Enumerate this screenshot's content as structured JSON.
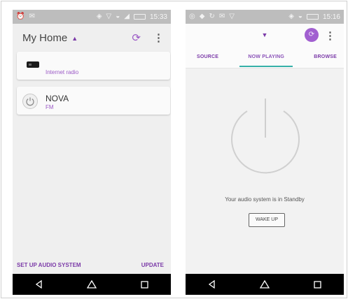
{
  "left_phone": {
    "status": {
      "time": "15:33"
    },
    "header": {
      "title": "My Home"
    },
    "devices": [
      {
        "title": "",
        "subtitle": "Internet radio"
      },
      {
        "title": "NOVA",
        "subtitle": "FM"
      }
    ],
    "footer": {
      "setup_label": "SET UP AUDIO SYSTEM",
      "update_label": "UPDATE"
    }
  },
  "right_phone": {
    "status": {
      "time": "15:16"
    },
    "tabs": [
      {
        "label": "SOURCE"
      },
      {
        "label": "NOW PLAYING"
      },
      {
        "label": "BROWSE"
      }
    ],
    "active_tab": "NOW PLAYING",
    "standby_message": "Your audio system is in Standby",
    "wake_label": "WAKE UP"
  },
  "icons": {
    "header_caret": "caret-up-icon",
    "refresh": "refresh-icon",
    "more": "more-vert-icon",
    "device_radio": "radio-device-icon",
    "device_power": "power-icon",
    "nav_back": "back-triangle-icon",
    "nav_home": "home-icon",
    "nav_recents": "recents-square-icon"
  },
  "colors": {
    "accent": "#7b3aa8",
    "tab_indicator": "#35b0a8",
    "avatar": "#a15fd0"
  }
}
